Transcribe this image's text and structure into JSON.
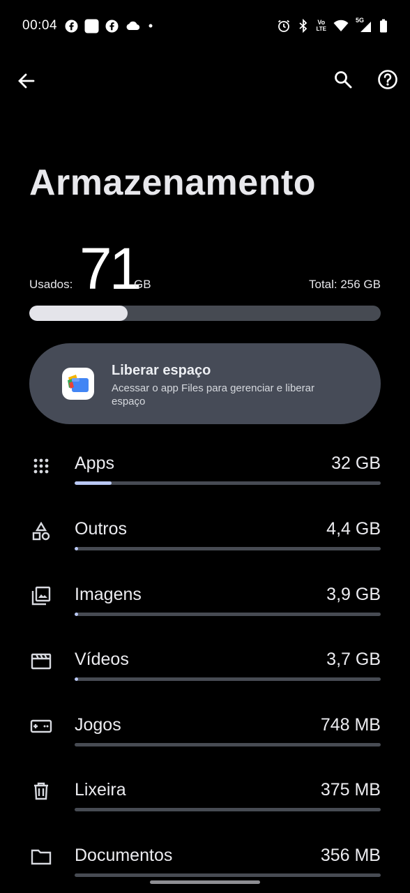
{
  "status_bar": {
    "time": "00:04",
    "left_icons": [
      "facebook-icon",
      "app-square-icon",
      "facebook-icon",
      "cloud-icon",
      "dot-icon"
    ],
    "right_icons": [
      "alarm-icon",
      "bluetooth-icon",
      "volte-icon",
      "wifi-icon",
      "signal-5g-icon",
      "battery-icon"
    ],
    "volte_top": "Vo",
    "volte_bottom": "LTE",
    "network": "5G"
  },
  "app_bar": {
    "back_icon": "arrow-back-icon",
    "search_icon": "search-icon",
    "help_icon": "help-icon"
  },
  "title": "Armazenamento",
  "usage": {
    "used_label": "Usados:",
    "used_value": "71",
    "used_unit": "GB",
    "total_label": "Total: 256 GB",
    "used_fraction": 0.28
  },
  "free_space_card": {
    "title": "Liberar espaço",
    "subtitle": "Acessar o app Files para gerenciar e liberar espaço",
    "icon": "files-app-icon"
  },
  "categories": [
    {
      "name": "Apps",
      "size": "32 GB",
      "icon": "apps-grid-icon",
      "fraction": 0.12
    },
    {
      "name": "Outros",
      "size": "4,4 GB",
      "icon": "shapes-icon",
      "fraction": 0.012
    },
    {
      "name": "Imagens",
      "size": "3,9 GB",
      "icon": "images-icon",
      "fraction": 0.011
    },
    {
      "name": "Vídeos",
      "size": "3,7 GB",
      "icon": "movie-icon",
      "fraction": 0.011
    },
    {
      "name": "Jogos",
      "size": "748 MB",
      "icon": "gamepad-icon",
      "fraction": 0.0
    },
    {
      "name": "Lixeira",
      "size": "375 MB",
      "icon": "trash-icon",
      "fraction": 0.0
    },
    {
      "name": "Documentos",
      "size": "356 MB",
      "icon": "folder-icon",
      "fraction": 0.0
    }
  ],
  "colors": {
    "background": "#000000",
    "card": "#464b57",
    "track": "#474b53",
    "accent": "#b9c8f4",
    "usage_fill": "#e4e4ea"
  }
}
